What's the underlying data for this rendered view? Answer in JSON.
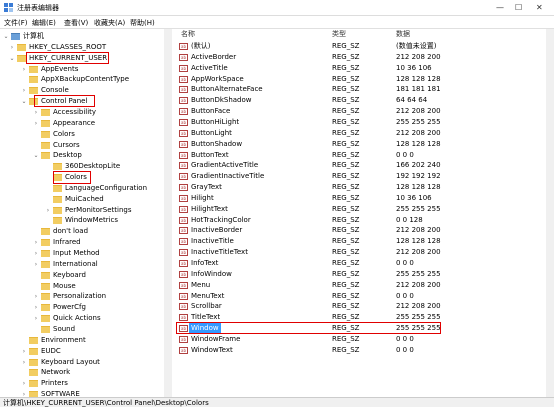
{
  "window": {
    "title": "注册表编辑器",
    "min": "—",
    "max": "☐",
    "close": "✕"
  },
  "menu": [
    "文件(F)",
    "编辑(E)",
    "查看(V)",
    "收藏夹(A)",
    "帮助(H)"
  ],
  "tree": [
    {
      "label": "计算机",
      "arrow": "⌄"
    },
    {
      "label": "HKEY_CLASSES_ROOT",
      "arrow": "›"
    },
    {
      "label": "HKEY_CURRENT_USER",
      "arrow": "⌄"
    },
    {
      "label": "AppEvents",
      "arrow": "›"
    },
    {
      "label": "AppXBackupContentType",
      "arrow": ""
    },
    {
      "label": "Console",
      "arrow": "›"
    },
    {
      "label": "Control Panel",
      "arrow": "⌄"
    },
    {
      "label": "Accessibility",
      "arrow": "›"
    },
    {
      "label": "Appearance",
      "arrow": "›"
    },
    {
      "label": "Colors",
      "arrow": ""
    },
    {
      "label": "Cursors",
      "arrow": ""
    },
    {
      "label": "Desktop",
      "arrow": "⌄"
    },
    {
      "label": "360DesktopLite",
      "arrow": ""
    },
    {
      "label": "Colors",
      "arrow": ""
    },
    {
      "label": "LanguageConfiguration",
      "arrow": ""
    },
    {
      "label": "MuiCached",
      "arrow": ""
    },
    {
      "label": "PerMonitorSettings",
      "arrow": "›"
    },
    {
      "label": "WindowMetrics",
      "arrow": ""
    },
    {
      "label": "don't load",
      "arrow": ""
    },
    {
      "label": "Infrared",
      "arrow": "›"
    },
    {
      "label": "Input Method",
      "arrow": "›"
    },
    {
      "label": "International",
      "arrow": "›"
    },
    {
      "label": "Keyboard",
      "arrow": ""
    },
    {
      "label": "Mouse",
      "arrow": ""
    },
    {
      "label": "Personalization",
      "arrow": "›"
    },
    {
      "label": "PowerCfg",
      "arrow": "›"
    },
    {
      "label": "Quick Actions",
      "arrow": "›"
    },
    {
      "label": "Sound",
      "arrow": ""
    },
    {
      "label": "Environment",
      "arrow": ""
    },
    {
      "label": "EUDC",
      "arrow": "›"
    },
    {
      "label": "Keyboard Layout",
      "arrow": "›"
    },
    {
      "label": "Network",
      "arrow": ""
    },
    {
      "label": "Printers",
      "arrow": "›"
    },
    {
      "label": "SOFTWARE",
      "arrow": "›"
    }
  ],
  "columns": {
    "name": "名称",
    "type": "类型",
    "data": "数据"
  },
  "values": [
    {
      "name": "(默认)",
      "type": "REG_SZ",
      "data": "(数值未设置)"
    },
    {
      "name": "ActiveBorder",
      "type": "REG_SZ",
      "data": "212 208 200"
    },
    {
      "name": "ActiveTitle",
      "type": "REG_SZ",
      "data": "10 36 106"
    },
    {
      "name": "AppWorkSpace",
      "type": "REG_SZ",
      "data": "128 128 128"
    },
    {
      "name": "ButtonAlternateFace",
      "type": "REG_SZ",
      "data": "181 181 181"
    },
    {
      "name": "ButtonDkShadow",
      "type": "REG_SZ",
      "data": "64 64 64"
    },
    {
      "name": "ButtonFace",
      "type": "REG_SZ",
      "data": "212 208 200"
    },
    {
      "name": "ButtonHiLight",
      "type": "REG_SZ",
      "data": "255 255 255"
    },
    {
      "name": "ButtonLight",
      "type": "REG_SZ",
      "data": "212 208 200"
    },
    {
      "name": "ButtonShadow",
      "type": "REG_SZ",
      "data": "128 128 128"
    },
    {
      "name": "ButtonText",
      "type": "REG_SZ",
      "data": "0 0 0"
    },
    {
      "name": "GradientActiveTitle",
      "type": "REG_SZ",
      "data": "166 202 240"
    },
    {
      "name": "GradientInactiveTitle",
      "type": "REG_SZ",
      "data": "192 192 192"
    },
    {
      "name": "GrayText",
      "type": "REG_SZ",
      "data": "128 128 128"
    },
    {
      "name": "Hilight",
      "type": "REG_SZ",
      "data": "10 36 106"
    },
    {
      "name": "HilightText",
      "type": "REG_SZ",
      "data": "255 255 255"
    },
    {
      "name": "HotTrackingColor",
      "type": "REG_SZ",
      "data": "0 0 128"
    },
    {
      "name": "InactiveBorder",
      "type": "REG_SZ",
      "data": "212 208 200"
    },
    {
      "name": "InactiveTitle",
      "type": "REG_SZ",
      "data": "128 128 128"
    },
    {
      "name": "InactiveTitleText",
      "type": "REG_SZ",
      "data": "212 208 200"
    },
    {
      "name": "InfoText",
      "type": "REG_SZ",
      "data": "0 0 0"
    },
    {
      "name": "InfoWindow",
      "type": "REG_SZ",
      "data": "255 255 255"
    },
    {
      "name": "Menu",
      "type": "REG_SZ",
      "data": "212 208 200"
    },
    {
      "name": "MenuText",
      "type": "REG_SZ",
      "data": "0 0 0"
    },
    {
      "name": "Scrollbar",
      "type": "REG_SZ",
      "data": "212 208 200"
    },
    {
      "name": "TitleText",
      "type": "REG_SZ",
      "data": "255 255 255"
    },
    {
      "name": "Window",
      "type": "REG_SZ",
      "data": "255 255 255"
    },
    {
      "name": "WindowFrame",
      "type": "REG_SZ",
      "data": "0 0 0"
    },
    {
      "name": "WindowText",
      "type": "REG_SZ",
      "data": "0 0 0"
    }
  ],
  "status": "计算机\\HKEY_CURRENT_USER\\Control Panel\\Desktop\\Colors",
  "colors": {
    "selection": "#3399ff",
    "highlight_border": "#e00000",
    "folder": "#f2cd62"
  }
}
